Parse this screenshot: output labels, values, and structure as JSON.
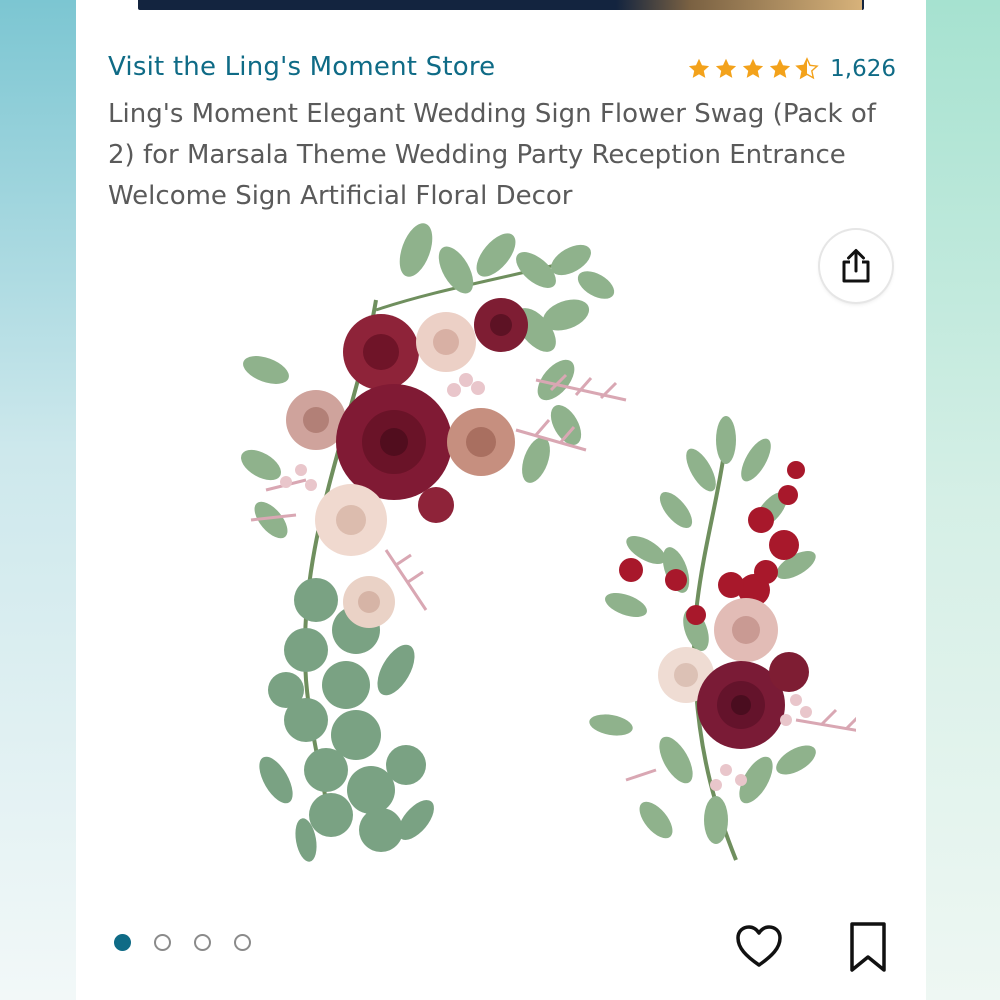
{
  "store": {
    "link_label": "Visit the Ling's Moment Store"
  },
  "rating": {
    "stars": 4.5,
    "count": "1,626",
    "star_color": "#f3a21b"
  },
  "product": {
    "title": "Ling's Moment Elegant Wedding Sign Flower Swag (Pack of 2) for Marsala Theme Wedding Party Reception Entrance Welcome Sign Artificial Floral Decor"
  },
  "carousel": {
    "total": 4,
    "active_index": 0,
    "active_color": "#0f6b86"
  },
  "actions": {
    "share_icon": "share-icon",
    "wishlist_icon": "heart-icon",
    "save_icon": "bookmark-icon"
  },
  "colors": {
    "link": "#0f6b86",
    "text": "#5a5a5a"
  }
}
